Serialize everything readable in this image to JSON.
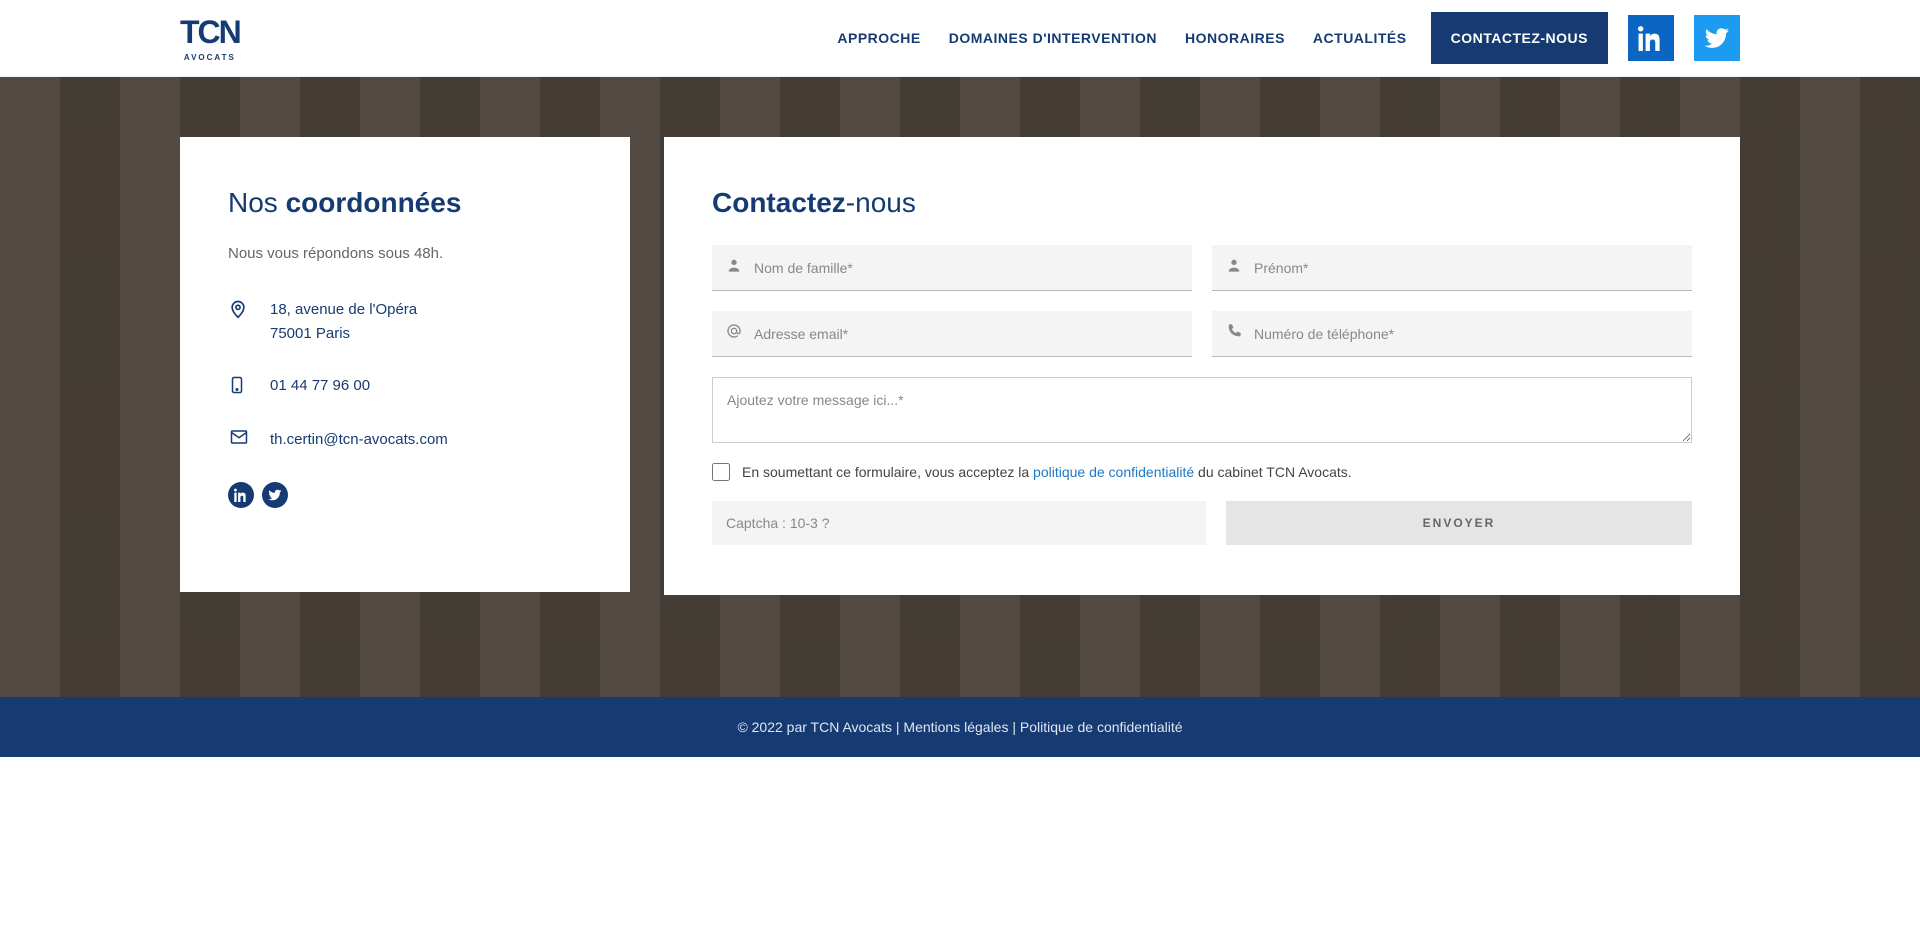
{
  "brand": {
    "logo_main": "TCN",
    "logo_sub": "AVOCATS"
  },
  "nav": {
    "approche": "APPROCHE",
    "domaines": "DOMAINES D'INTERVENTION",
    "honoraires": "HONORAIRES",
    "actualites": "ACTUALITÉS",
    "contact": "CONTACTEZ-NOUS"
  },
  "coords": {
    "title_light": "Nos ",
    "title_bold": "coordonnées",
    "subtitle": "Nous vous répondons sous 48h.",
    "address_line1": "18, avenue de l'Opéra",
    "address_line2": "75001 Paris",
    "phone": "01 44 77 96 00",
    "email": "th.certin@tcn-avocats.com"
  },
  "form": {
    "title_bold": "Contactez",
    "title_light": "-nous",
    "lastname_ph": "Nom de famille*",
    "firstname_ph": "Prénom*",
    "email_ph": "Adresse email*",
    "phone_ph": "Numéro de téléphone*",
    "message_ph": "Ajoutez votre message ici...*",
    "consent_pre": "En soumettant ce formulaire, vous acceptez la ",
    "consent_link": "politique de confidentialité",
    "consent_post": " du cabinet TCN Avocats.",
    "captcha_ph": "Captcha : 10-3 ?",
    "send": "ENVOYER"
  },
  "footer": {
    "copyright": "© 2022 par TCN Avocats",
    "sep1": " | ",
    "legal": "Mentions légales",
    "sep2": " | ",
    "privacy": "Politique de confidentialité"
  }
}
